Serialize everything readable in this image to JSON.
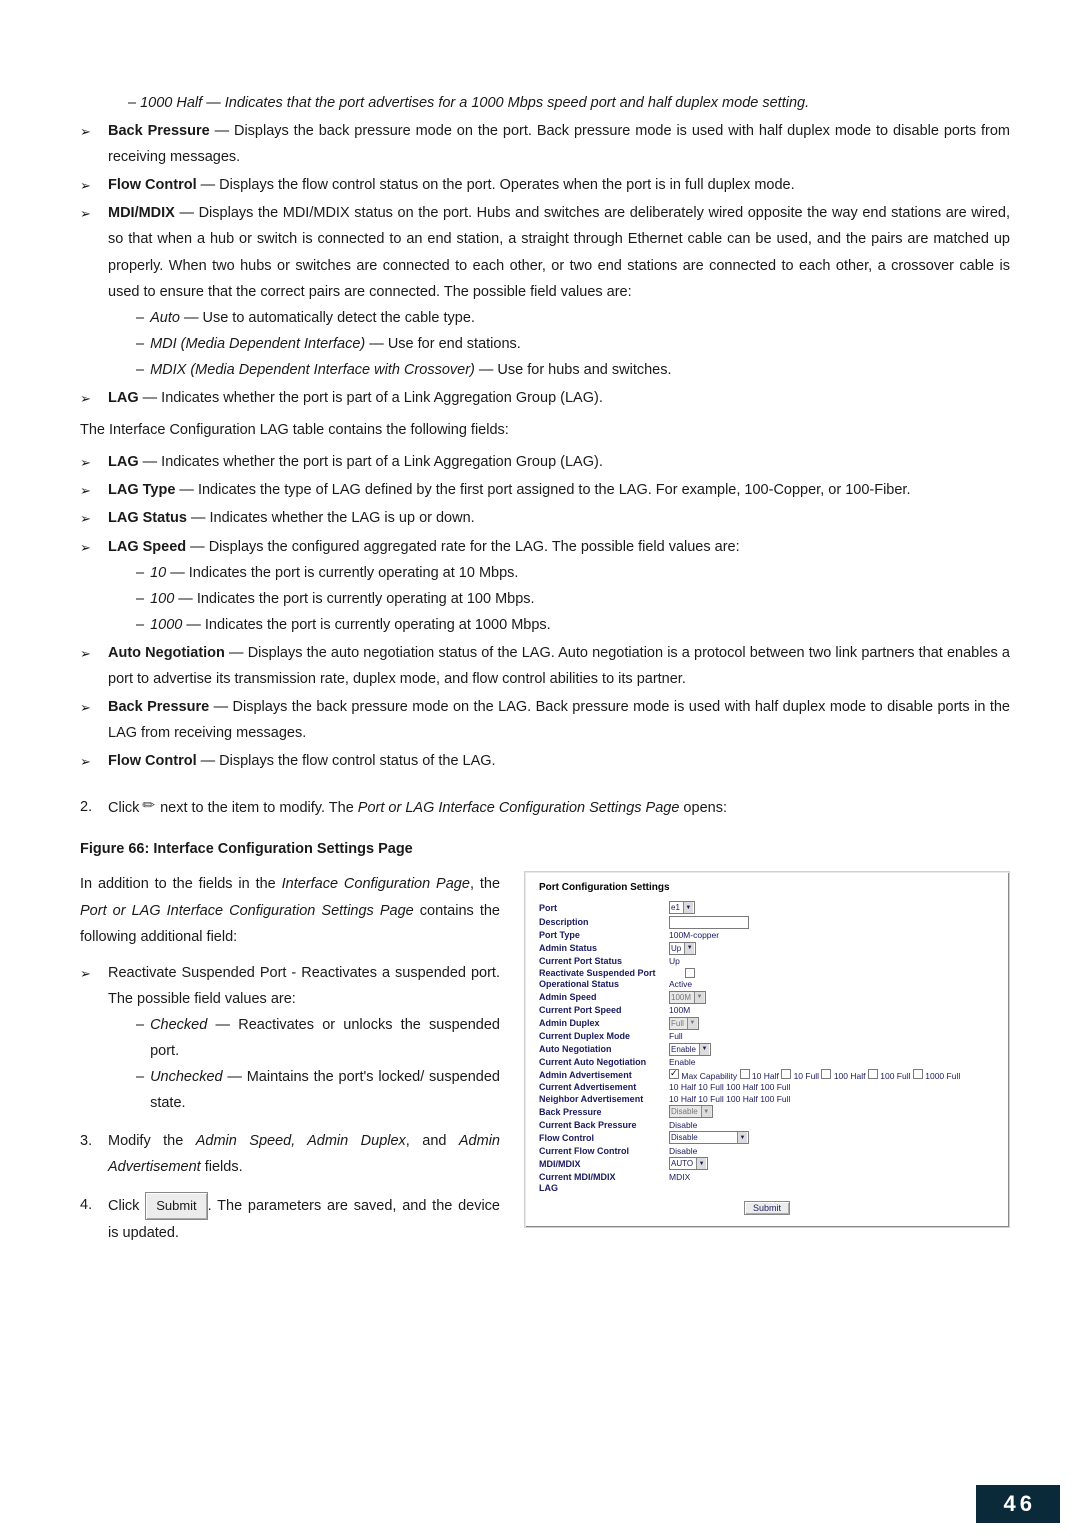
{
  "top": {
    "half1000_line": "– 1000 Half — Indicates that the port advertises for a 1000 Mbps speed port and half duplex mode setting.",
    "back_pressure_label": "Back Pressure",
    "back_pressure_text": " — Displays the back pressure mode on the port. Back pressure mode is used with half duplex mode to disable ports from receiving messages.",
    "flow_label": "Flow Control",
    "flow_text": " — Displays the flow control status on the port. Operates when the port is in full duplex mode.",
    "mdi_label": "MDI/MDIX",
    "mdi_text": " — Displays the MDI/MDIX status on the port. Hubs and switches are deliberately wired opposite the way end stations are wired, so that when a hub or switch is connected to an end station, a straight through Ethernet cable can be used, and the pairs are matched up properly. When two hubs or switches are connected to each other, or two end stations are connected to each other, a crossover cable is used to ensure that the correct pairs are connected. The possible field values are:",
    "mdi_auto_i": "Auto",
    "mdi_auto_r": " — Use to automatically detect the cable type.",
    "mdi_mdi_i": "MDI (Media Dependent Interface)",
    "mdi_mdi_r": " — Use for end stations.",
    "mdi_mdix_i": "MDIX (Media Dependent Interface with Crossover)",
    "mdi_mdix_r": " — Use for hubs and switches.",
    "lag_label": "LAG",
    "lag_text": " — Indicates whether the port is part of a Link Aggregation Group (LAG)."
  },
  "lagtable": {
    "intro": "The Interface Configuration LAG table contains the following fields:",
    "lag_label": "LAG",
    "lag_text": " — Indicates whether the port is part of a Link Aggregation Group (LAG).",
    "type_label": "LAG Type",
    "type_text": " — Indicates the type of LAG defined by the first port assigned to the LAG. For example, 100-Copper, or 100-Fiber.",
    "status_label": "LAG Status",
    "status_text": " — Indicates whether the LAG is up or down.",
    "speed_label": "LAG Speed",
    "speed_text": " — Displays the configured aggregated rate for the LAG. The possible field values are:",
    "s10_i": "10",
    "s10_r": " — Indicates the port is currently operating at 10 Mbps.",
    "s100_i": "100",
    "s100_r": " — Indicates the port is currently operating at 100 Mbps.",
    "s1000_i": "1000",
    "s1000_r": " — Indicates the port is currently operating at 1000 Mbps.",
    "auto_label": "Auto Negotiation",
    "auto_text": " — Displays the auto negotiation status of the LAG. Auto negotiation is a protocol between two link partners that enables a port to advertise its transmission rate, duplex mode, and flow control abilities to its partner.",
    "bp_label": "Back Pressure",
    "bp_text": " — Displays the back pressure mode on the LAG. Back pressure mode is used with half duplex mode to disable ports in the LAG from receiving messages.",
    "fc_label": "Flow Control",
    "fc_text": " — Displays the flow control status of the LAG."
  },
  "step2": {
    "num": "2.",
    "pre": "Click ",
    "mid": " next to the item to modify. The ",
    "page_i": "Port or LAG Interface Configuration Settings Page",
    "post": " opens:"
  },
  "fig_title": "Figure 66: Interface Configuration Settings Page",
  "left": {
    "p1a": "In addition to the fields in the ",
    "p1i": "Interface Configuration Page",
    "p1b": ", the ",
    "p1i2": "Port or LAG Interface Configuration Settings Page",
    "p1c": " contains the following additional field:",
    "react_text": "Reactivate Suspended Port - Reactivates a suspended port. The possible field values are:",
    "chk_i": "Checked",
    "chk_r": " — Reactivates or unlocks the suspended port.",
    "unchk_i": "Unchecked",
    "unchk_r": " — Maintains the port's locked/ suspended state.",
    "s3num": "3.",
    "s3a": "Modify the ",
    "s3i": "Admin Speed, Admin Duplex",
    "s3b": ", and ",
    "s3i2": "Admin Advertisement",
    "s3c": " fields.",
    "s4num": "4.",
    "s4a": "Click ",
    "s4btn": "Submit",
    "s4b": ". The parameters are saved, and the device is updated."
  },
  "panel": {
    "title": "Port Configuration Settings",
    "rows": {
      "port_l": "Port",
      "port_v": "e1",
      "desc_l": "Description",
      "ptype_l": "Port Type",
      "ptype_v": "100M-copper",
      "astat_l": "Admin Status",
      "astat_v": "Up",
      "cpstat_l": "Current Port Status",
      "cpstat_v": "Up",
      "react_l": "Reactivate Suspended Port",
      "opstat_l": "Operational Status",
      "opstat_v": "Active",
      "aspd_l": "Admin Speed",
      "aspd_v": "100M",
      "cspd_l": "Current Port Speed",
      "cspd_v": "100M",
      "adup_l": "Admin Duplex",
      "adup_v": "Full",
      "cdup_l": "Current Duplex Mode",
      "cdup_v": "Full",
      "aneg_l": "Auto Negotiation",
      "aneg_v": "Enable",
      "caneg_l": "Current Auto Negotiation",
      "caneg_v": "Enable",
      "aadv_l": "Admin Advertisement",
      "aadv_cap": "Max Capability",
      "aadv_10h": "10 Half",
      "aadv_10f": "10 Full",
      "aadv_100h": "100 Half",
      "aadv_100f": "100 Full",
      "aadv_1000f": "1000 Full",
      "cadv_l": "Current Advertisement",
      "cadv_v": "10 Half 10 Full 100 Half 100 Full",
      "nadv_l": "Neighbor Advertisement",
      "nadv_v": "10 Half 10 Full 100 Half 100 Full",
      "bp_l": "Back Pressure",
      "bp_v": "Disable",
      "cbp_l": "Current Back Pressure",
      "cbp_v": "Disable",
      "fc_l": "Flow Control",
      "fc_v": "Disable",
      "cfc_l": "Current Flow Control",
      "cfc_v": "Disable",
      "mdi_l": "MDI/MDIX",
      "mdi_v": "AUTO",
      "cmdi_l": "Current MDI/MDIX",
      "cmdi_v": "MDIX",
      "lag_l": "LAG"
    },
    "submit": "Submit"
  },
  "page_number": "46"
}
